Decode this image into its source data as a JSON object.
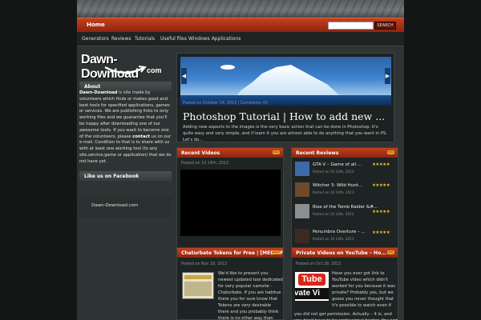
{
  "header": {
    "home": "Home",
    "search_button": "SEARCH",
    "search_placeholder": "",
    "nav": [
      "Generators",
      "Reviews",
      "Tutorials",
      "Useful files",
      "Windows Applications"
    ]
  },
  "sidebar": {
    "logo_main": "Dawn-Download",
    "logo_sub": "com",
    "about_title": "About",
    "about_site": "Dawn-Download",
    "about_text": " is site made by volunteers which finds or makes good and best tools for specified applications, games or services. We are publishing links to only working files and we guarantee that you'll be happy after downloading one of our awesome tools. If you want to become one of the volunteers, please ",
    "about_contact": "contact",
    "about_text2": " us on our e-mail. Condition to that is to share with us with at least one working tool (to any site,service,game or application) that we do not have yet.",
    "facebook_title": "Like us on Facebook",
    "facebook_link": "Dawn-Download.com"
  },
  "slider": {
    "meta": "Posted on October 24, 2013 | Comments (0)",
    "title": "Photoshop Tutorial | How to add new ...",
    "excerpt": "Adding new aspects to the images is the very basic action that can be done in Photoshop. It's quite easy and very simple, and if learn it you are almost able to do anything that you want in PS. Let's do..."
  },
  "recent_videos": {
    "title": "Recent Videos",
    "meta": "Posted on 10 14th, 2013"
  },
  "recent_reviews": {
    "title": "Recent Reviews",
    "items": [
      {
        "title": "GTA V – Game of all ...",
        "date": "Posted on 10 14th, 2013",
        "stars": "★★★★★",
        "color": "#3d6aa8"
      },
      {
        "title": "Witcher 3: Wild Hunt...",
        "date": "Posted on 10 14th, 2013",
        "stars": "★★★★★",
        "color": "#6b4a2e"
      },
      {
        "title": "Rise of the Tomb Raider &#...",
        "date": "Posted on 10 14th, 2013",
        "stars": "★★★★★",
        "color": "#8a8f90"
      },
      {
        "title": "Penumbra Overture – ...",
        "date": "Posted on 10 14th, 2013",
        "stars": "★★★★★",
        "color": "#3a2a22"
      }
    ]
  },
  "post_left": {
    "title": "Chaturbate Tokens for Free | [MEDIAF...",
    "meta": "Posted on Nov 29, 2013",
    "text": "We'd like to present you newest updated tool dedicated for very popular camsite - Chaturbate. If you are habitue there you for sure know that Tokens are very desirable there and you probably think there is no other way than paying real money for them. You are totally wrong."
  },
  "post_right": {
    "title": "Private Videos on YouTube – Ho...",
    "meta": "Posted on Oct 29, 2013",
    "thumb_word1": "Tube",
    "thumb_word2": "vate Vi",
    "text_short": "Have you ever got link to YouTube video which didn't worked for you because it was private? Probably yes, but we guess you never thought that it's possible to watch even if",
    "text_full": "you did not get permission. Actually – it is, and you don't have to be professional hacker. You just need"
  },
  "colors": {
    "accent": "#b3361a",
    "stars": "#f4c01e",
    "background": "#2b2f2e"
  }
}
